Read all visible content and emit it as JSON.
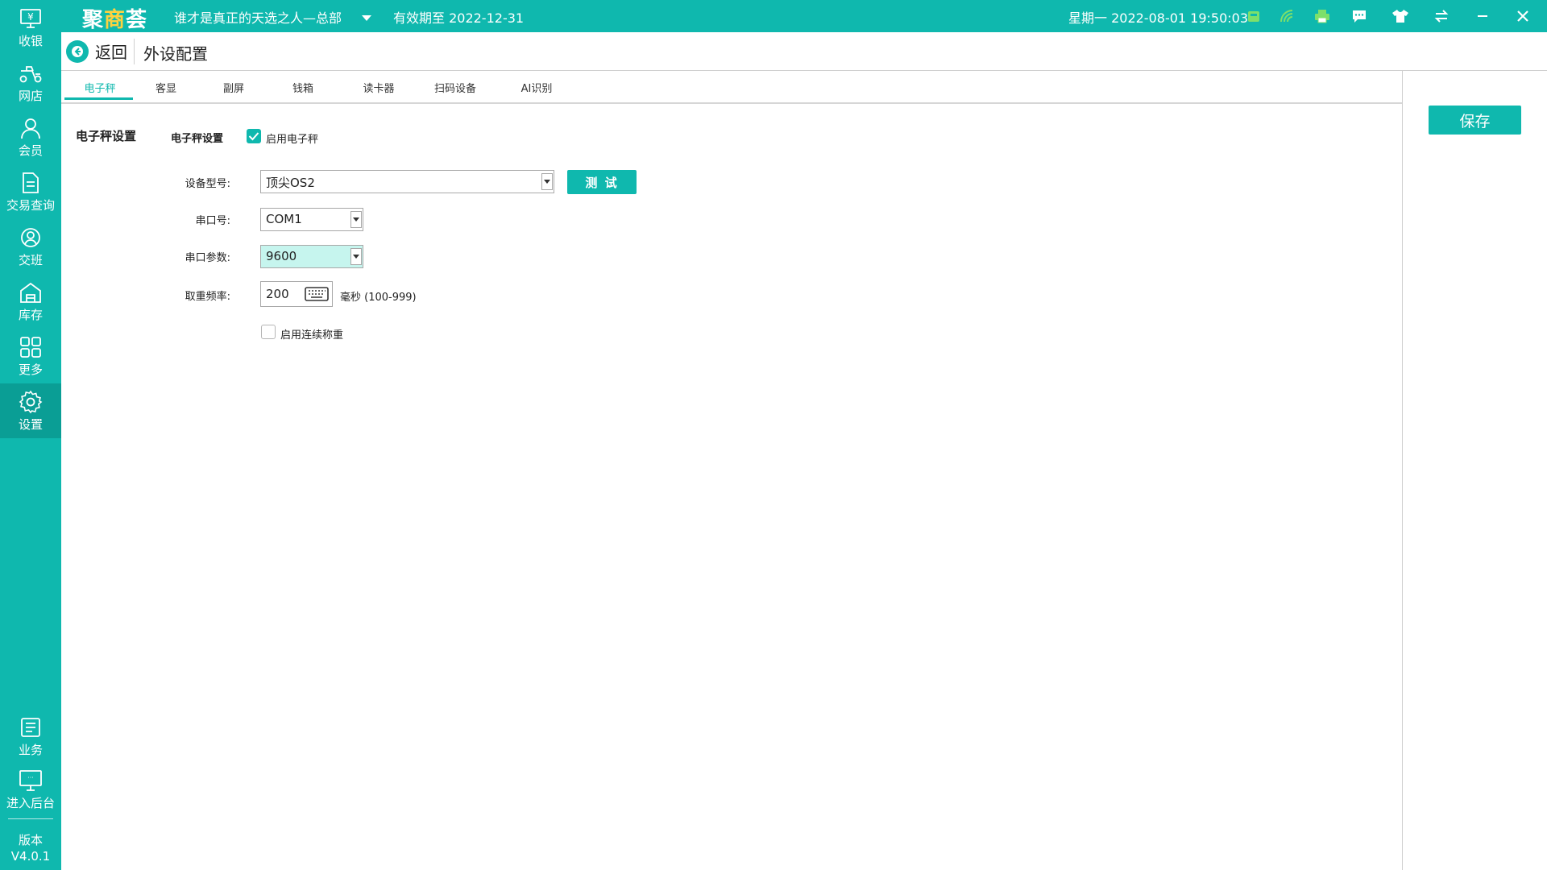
{
  "sidebar": {
    "items": [
      {
        "label": "收银",
        "icon": "cashier-icon"
      },
      {
        "label": "网店",
        "icon": "online-store-icon"
      },
      {
        "label": "会员",
        "icon": "member-icon"
      },
      {
        "label": "交易查询",
        "icon": "transaction-query-icon"
      },
      {
        "label": "交班",
        "icon": "shift-handover-icon"
      },
      {
        "label": "库存",
        "icon": "inventory-icon"
      },
      {
        "label": "更多",
        "icon": "more-grid-icon"
      },
      {
        "label": "设置",
        "icon": "gear-icon",
        "active": true
      },
      {
        "label": "业务",
        "icon": "business-icon"
      },
      {
        "label": "进入后台",
        "icon": "backend-monitor-icon"
      }
    ],
    "version_label": "版本",
    "version_value": "V4.0.1"
  },
  "topbar": {
    "logo_prefix": "聚",
    "logo_highlight": "商",
    "logo_suffix": "荟",
    "store_name": "谁才是真正的天选之人—总部",
    "expiry": "有效期至 2022-12-31",
    "datetime": "星期一 2022-08-01 19:50:03",
    "icons": [
      "cash-drawer-icon",
      "wifi-icon",
      "printer-icon",
      "message-icon",
      "skin-tshirt-icon",
      "swap-icon",
      "minimize-icon",
      "close-icon"
    ]
  },
  "header": {
    "back_label": "返回",
    "title": "外设配置"
  },
  "tabs": [
    "电子秤",
    "客显",
    "副屏",
    "钱箱",
    "读卡器",
    "扫码设备",
    "AI识别"
  ],
  "active_tab": "电子秤",
  "form": {
    "section_title": "电子秤设置",
    "subsection_title": "电子秤设置",
    "enable_scale_label": "启用电子秤",
    "enable_scale_checked": true,
    "device_model_label": "设备型号:",
    "device_model_value": "顶尖OS2",
    "test_button": "测 试",
    "port_label": "串口号:",
    "port_value": "COM1",
    "baud_label": "串口参数:",
    "baud_value": "9600",
    "freq_label": "取重频率:",
    "freq_value": "200",
    "freq_unit": "毫秒 (100-999)",
    "continuous_label": "启用连续称重",
    "continuous_checked": false
  },
  "save_button": "保存",
  "colors": {
    "brand": "#0fb8ae",
    "brand_dark": "#0a9e95",
    "highlight_field": "#c6f5ee",
    "logo_accent": "#ffd23f"
  }
}
